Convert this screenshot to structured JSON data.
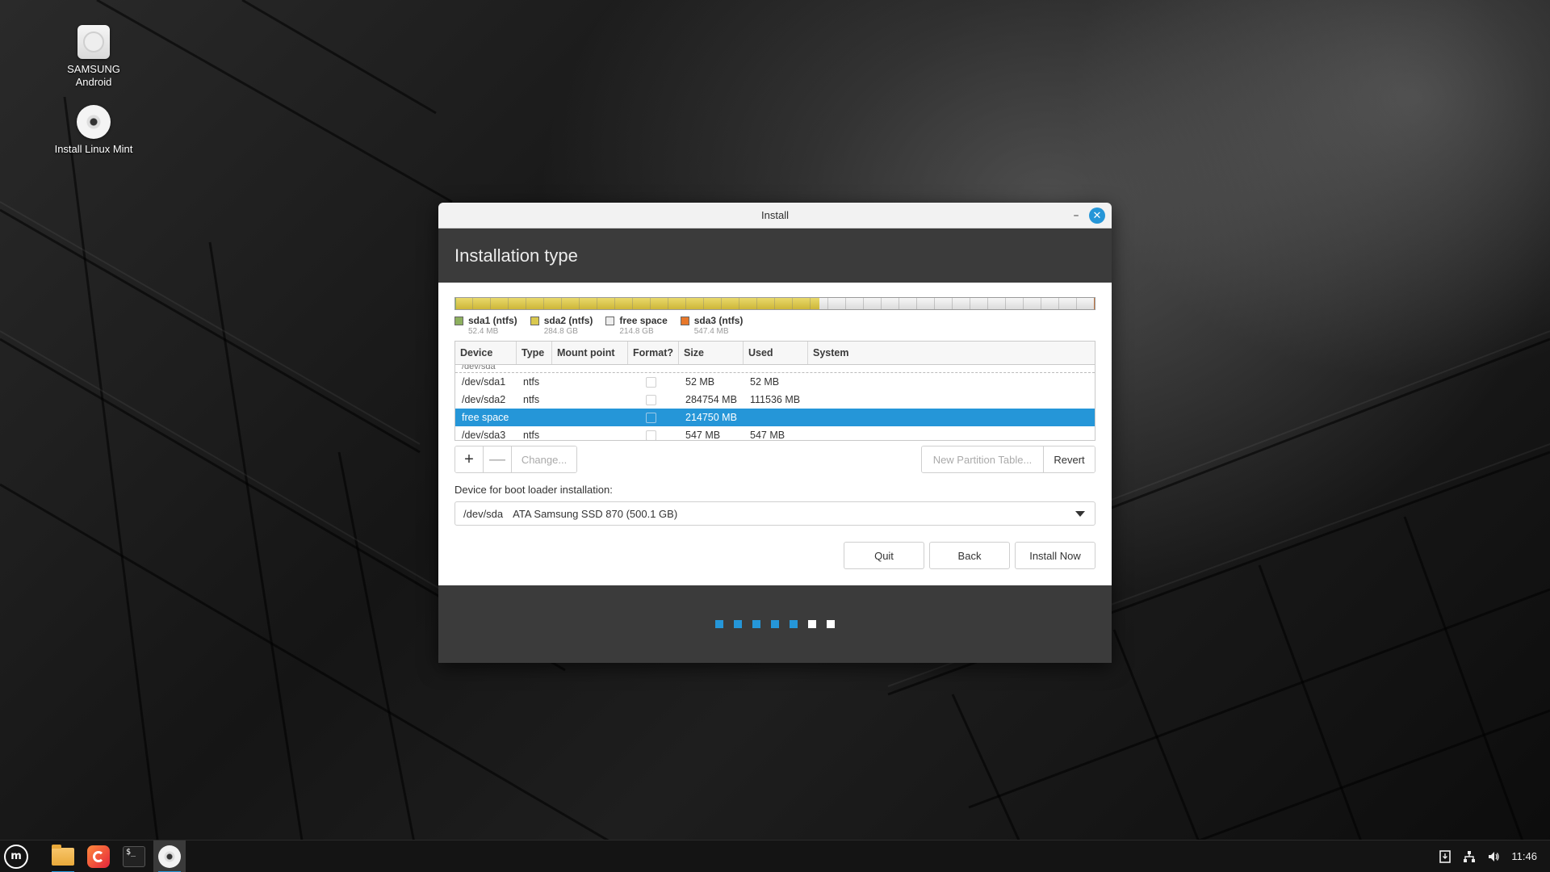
{
  "desktop": {
    "icons": [
      {
        "label_line1": "SAMSUNG",
        "label_line2": "Android",
        "icon": "drive-icon"
      },
      {
        "label_line1": "Install Linux Mint",
        "label_line2": "",
        "icon": "disc-icon"
      }
    ]
  },
  "window": {
    "title": "Install",
    "minimize_glyph": "–",
    "close_glyph": "✕"
  },
  "page": {
    "heading": "Installation type"
  },
  "partition_bar": {
    "segments": [
      {
        "name": "sda1 (ntfs)",
        "size": "52.4 MB",
        "fraction": 0.0001,
        "color": "#8db05e"
      },
      {
        "name": "sda2 (ntfs)",
        "size": "284.8 GB",
        "fraction": 0.569,
        "color": "#d9c84e"
      },
      {
        "name": "free space",
        "size": "214.8 GB",
        "fraction": 0.4299,
        "color": "#eeeeee"
      },
      {
        "name": "sda3 (ntfs)",
        "size": "547.4 MB",
        "fraction": 0.0011,
        "color": "#e8782b"
      }
    ]
  },
  "table": {
    "headers": [
      "Device",
      "Type",
      "Mount point",
      "Format?",
      "Size",
      "Used",
      "System"
    ],
    "cut_row": "/dev/sda",
    "rows": [
      {
        "device": "/dev/sda1",
        "type": "ntfs",
        "mount": "",
        "size": "52 MB",
        "used": "52 MB",
        "system": "",
        "selected": false
      },
      {
        "device": "/dev/sda2",
        "type": "ntfs",
        "mount": "",
        "size": "284754 MB",
        "used": "111536 MB",
        "system": "",
        "selected": false
      },
      {
        "device": "free space",
        "type": "",
        "mount": "",
        "size": "214750 MB",
        "used": "",
        "system": "",
        "selected": true
      },
      {
        "device": "/dev/sda3",
        "type": "ntfs",
        "mount": "",
        "size": "547 MB",
        "used": "547 MB",
        "system": "",
        "selected": false
      }
    ]
  },
  "actions": {
    "add": "+",
    "remove": "—",
    "change": "Change...",
    "new_partition_table": "New Partition Table...",
    "revert": "Revert"
  },
  "bootloader": {
    "label": "Device for boot loader installation:",
    "device": "/dev/sda",
    "description": "ATA Samsung SSD 870 (500.1 GB)"
  },
  "buttons": {
    "quit": "Quit",
    "back": "Back",
    "install_now": "Install Now"
  },
  "progress": {
    "total_steps": 7,
    "completed_steps": 5,
    "accent": "#2596d8"
  },
  "taskbar": {
    "menu_glyph": "m",
    "terminal_glyph": "$_",
    "clock": "11:46"
  }
}
